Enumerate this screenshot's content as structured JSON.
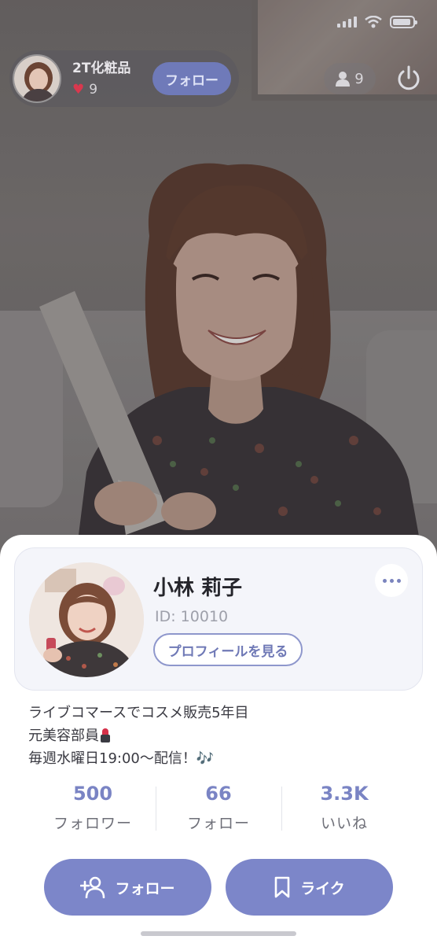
{
  "host": {
    "name": "2T化粧品",
    "likes": "9",
    "follow_label": "フォロー"
  },
  "viewers": "9",
  "profile": {
    "name": "小林 莉子",
    "id": "ID: 10010",
    "view_profile_label": "プロフィールを見る",
    "bio_line1": "ライブコマースでコスメ販売5年目",
    "bio_line2": "元美容部員",
    "bio_line3": "毎週水曜日19:00〜配信！🎶"
  },
  "stats": [
    {
      "value": "500",
      "label": "フォロワー"
    },
    {
      "value": "66",
      "label": "フォロー"
    },
    {
      "value": "3.3K",
      "label": "いいね"
    }
  ],
  "actions": {
    "follow_label": "フォロー",
    "like_label": "ライク"
  },
  "colors": {
    "accent": "#7c86c9",
    "accent_text": "#7a84c4",
    "heart": "#d9384e"
  }
}
